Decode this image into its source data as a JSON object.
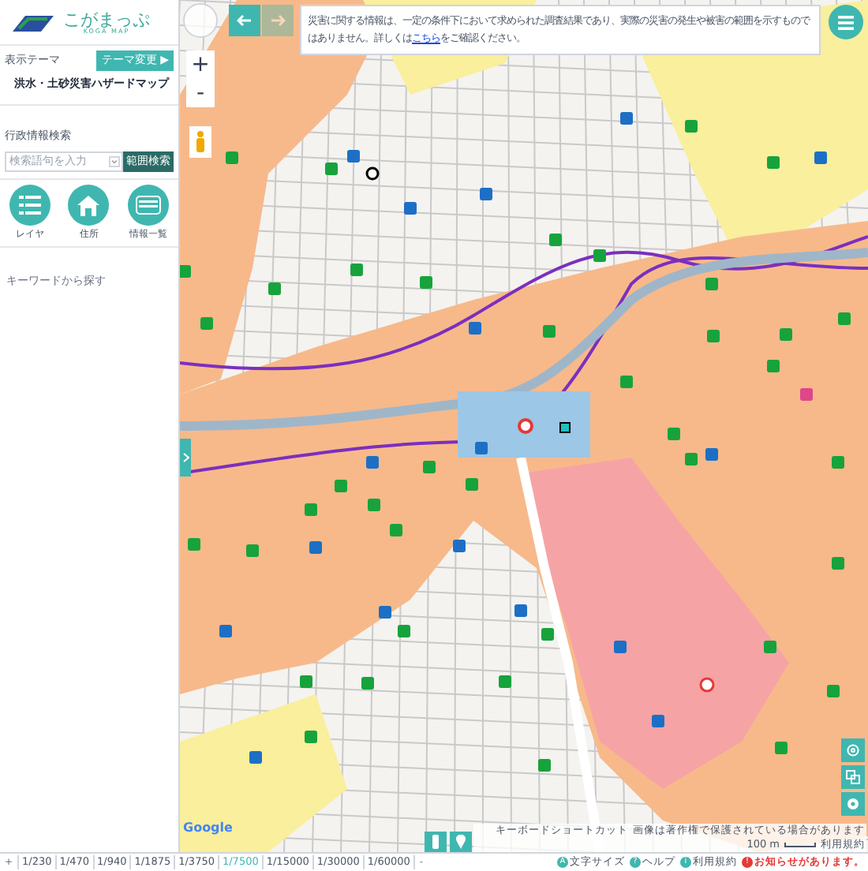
{
  "logo": {
    "title": "こがまっぷ",
    "subtitle": "KOGA MAP"
  },
  "theme": {
    "label": "表示テーマ",
    "button": "テーマ変更",
    "button_icon": "▶",
    "name": "洪水・土砂災害ハザードマップ"
  },
  "search": {
    "label": "行政情報検索",
    "placeholder": "検索語句を入力",
    "button": "範囲検索"
  },
  "tools": [
    {
      "label": "レイヤ",
      "kind": "layers"
    },
    {
      "label": "住所",
      "kind": "house"
    },
    {
      "label": "情報一覧",
      "kind": "list"
    }
  ],
  "keyword": "キーワードから探す",
  "notice": {
    "text_before": "災害に関する情報は、一定の条件下において求められた調査結果であり、実際の災害の発生や被害の範囲を示すものではありません。詳しくは",
    "link": "こちら",
    "text_after": "をご確認ください。"
  },
  "map_provider": "Google",
  "nav": {
    "back_disabled": false,
    "forward_disabled": true
  },
  "attribution": {
    "shortcuts": "キーボードショートカット",
    "copyright": "画像は著作権で保護されている場合があります",
    "scale": "100 m",
    "terms": "利用規約"
  },
  "scales": {
    "plus": "+",
    "minus": "-",
    "items": [
      {
        "label": "1/230",
        "selected": false
      },
      {
        "label": "1/470",
        "selected": false
      },
      {
        "label": "1/940",
        "selected": false
      },
      {
        "label": "1/1875",
        "selected": false
      },
      {
        "label": "1/3750",
        "selected": false
      },
      {
        "label": "1/7500",
        "selected": true
      },
      {
        "label": "1/15000",
        "selected": false
      },
      {
        "label": "1/30000",
        "selected": false
      },
      {
        "label": "1/60000",
        "selected": false
      }
    ]
  },
  "footer_links": [
    {
      "label": "文字サイズ",
      "icon": "A",
      "alert": false
    },
    {
      "label": "ヘルプ",
      "icon": "?",
      "alert": false
    },
    {
      "label": "利用規約",
      "icon": "i",
      "alert": false
    },
    {
      "label": "お知らせがあります。",
      "icon": "!",
      "alert": true
    }
  ]
}
